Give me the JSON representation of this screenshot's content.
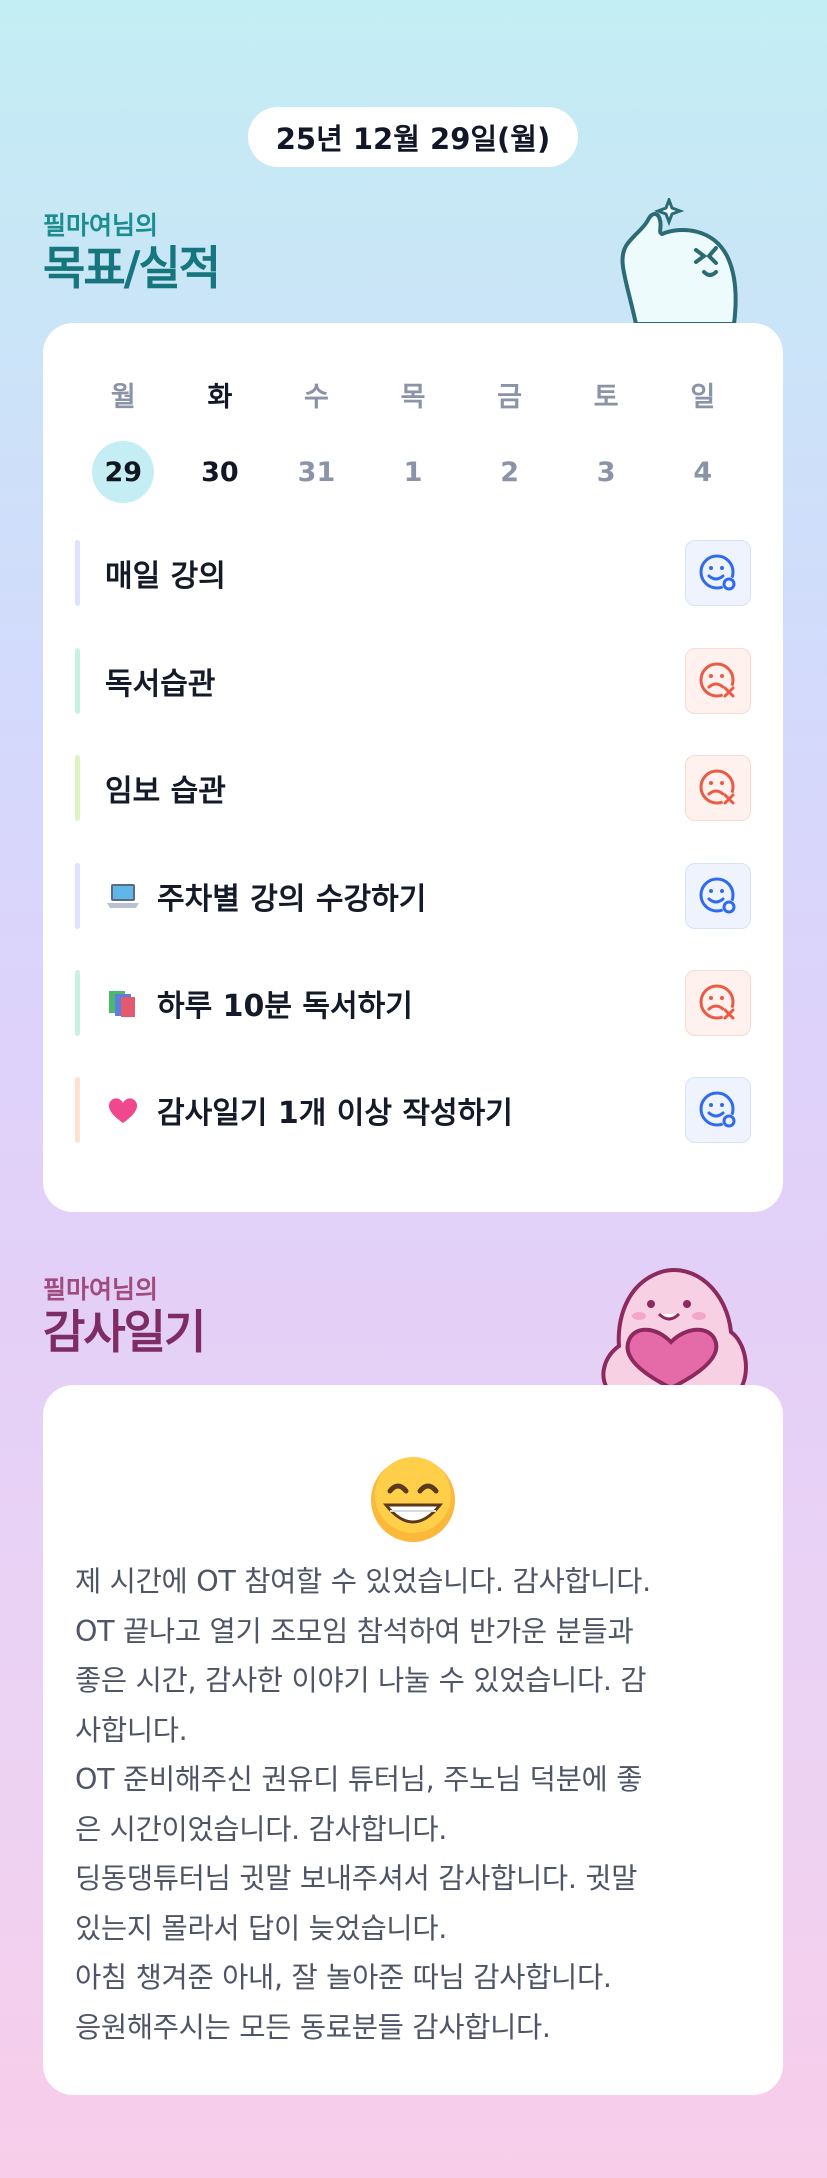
{
  "header": {
    "date": "25년 12월 29일(월)"
  },
  "goals_section": {
    "owner": "필마여님의",
    "title": "목표/실적"
  },
  "calendar": {
    "days": [
      "월",
      "화",
      "수",
      "목",
      "금",
      "토",
      "일"
    ],
    "dates": [
      "29",
      "30",
      "31",
      "1",
      "2",
      "3",
      "4"
    ]
  },
  "habits": [
    {
      "label": "매일 강의",
      "status": "success",
      "bar_color": "#dbe4fb",
      "icon": ""
    },
    {
      "label": "독서습관",
      "status": "fail",
      "bar_color": "#c9f1e3",
      "icon": ""
    },
    {
      "label": "임보 습관",
      "status": "fail",
      "bar_color": "#dcf4c2",
      "icon": ""
    },
    {
      "label": "주차별 강의 수강하기",
      "status": "success",
      "bar_color": "#dbe4fb",
      "icon": "laptop-emoji"
    },
    {
      "label": "하루 10분 독서하기",
      "status": "fail",
      "bar_color": "#c9f1e3",
      "icon": "books-emoji"
    },
    {
      "label": "감사일기 1개 이상 작성하기",
      "status": "success",
      "bar_color": "#fde3cf",
      "icon": "heart-emoji"
    }
  ],
  "diary_section": {
    "owner": "필마여님의",
    "title": "감사일기"
  },
  "diary": {
    "emoji": "grinning-face-emoji",
    "text": "제 시간에 OT 참여할 수 있었습니다. 감사합니다.\nOT 끝나고 열기 조모임 참석하여 반가운 분들과\n좋은 시간, 감사한 이야기 나눌 수 있었습니다. 감\n사합니다.\nOT 준비해주신 권유디 튜터님, 주노님 덕분에 좋\n은 시간이었습니다. 감사합니다.\n딩동댕튜터님 귓말 보내주셔서 감사합니다. 귓말\n있는지 몰라서 답이 늦었습니다.\n아침 챙겨준 아내, 잘 놀아준 따님 감사합니다.\n응원해주시는 모든 동료분들 감사합니다."
  },
  "colors": {
    "success": "#2f6bf0",
    "fail": "#ea5a45",
    "today_highlight": "#c4eef4"
  }
}
